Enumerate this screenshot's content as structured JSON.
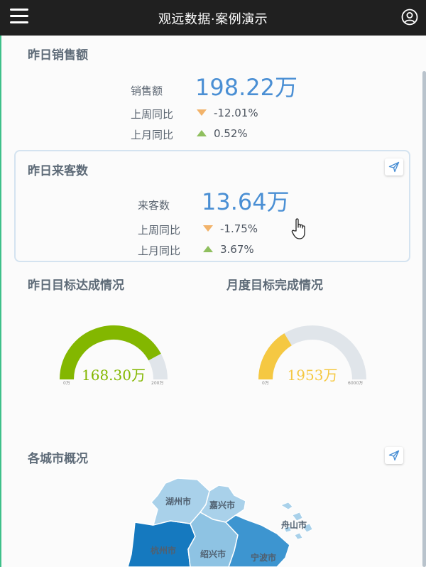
{
  "header": {
    "title": "观远数据·案例演示",
    "menu_icon": "menu-icon",
    "user_icon": "user-icon"
  },
  "sales": {
    "title": "昨日销售额",
    "metric_label": "销售额",
    "metric_value": "198.22万",
    "week_label": "上周同比",
    "week_value": "-12.01%",
    "month_label": "上月同比",
    "month_value": "0.52%"
  },
  "visitors": {
    "title": "昨日来客数",
    "metric_label": "来客数",
    "metric_value": "13.64万",
    "week_label": "上周同比",
    "week_value": "-1.75%",
    "month_label": "上月同比",
    "month_value": "3.67%",
    "share_icon": "send-icon"
  },
  "gauges": [
    {
      "title": "昨日目标达成情况",
      "value_text": "168.30万",
      "value": 168.3,
      "min": 0,
      "max": 200,
      "min_label": "0万",
      "max_label": "200万",
      "color": "#83b700"
    },
    {
      "title": "月度目标完成情况",
      "value_text": "1953万",
      "value": 1953,
      "min": 0,
      "max": 6000,
      "min_label": "0万",
      "max_label": "6000万",
      "color": "#f5c842"
    }
  ],
  "cities": {
    "title": "各城市概况",
    "share_icon": "send-icon",
    "labels": [
      "湖州市",
      "嘉兴市",
      "舟山市",
      "杭州市",
      "绍兴市",
      "宁波市"
    ]
  },
  "colors": {
    "accent": "#4a8fd4",
    "down": "#f2b36a",
    "up": "#8fbf5e",
    "topbar": "#202020"
  }
}
